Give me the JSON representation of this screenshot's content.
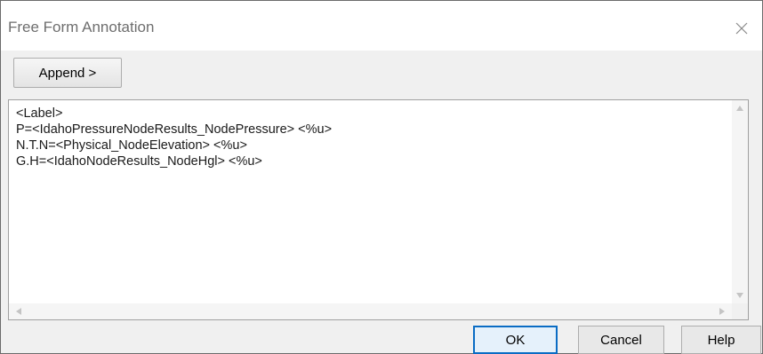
{
  "window": {
    "title": "Free Form Annotation",
    "close_icon": "close-icon"
  },
  "toolbar": {
    "append_label": "Append >"
  },
  "editor": {
    "lines": [
      "<Label>",
      "P=<IdahoPressureNodeResults_NodePressure> <%u>",
      "N.T.N=<Physical_NodeElevation> <%u>",
      "G.H=<IdahoNodeResults_NodeHgl> <%u>"
    ]
  },
  "buttons": {
    "ok": "OK",
    "cancel": "Cancel",
    "help": "Help"
  },
  "colors": {
    "default_button_border": "#0a6cc4",
    "default_button_fill": "#e5f1fb",
    "title_text": "#6e6e6e"
  }
}
